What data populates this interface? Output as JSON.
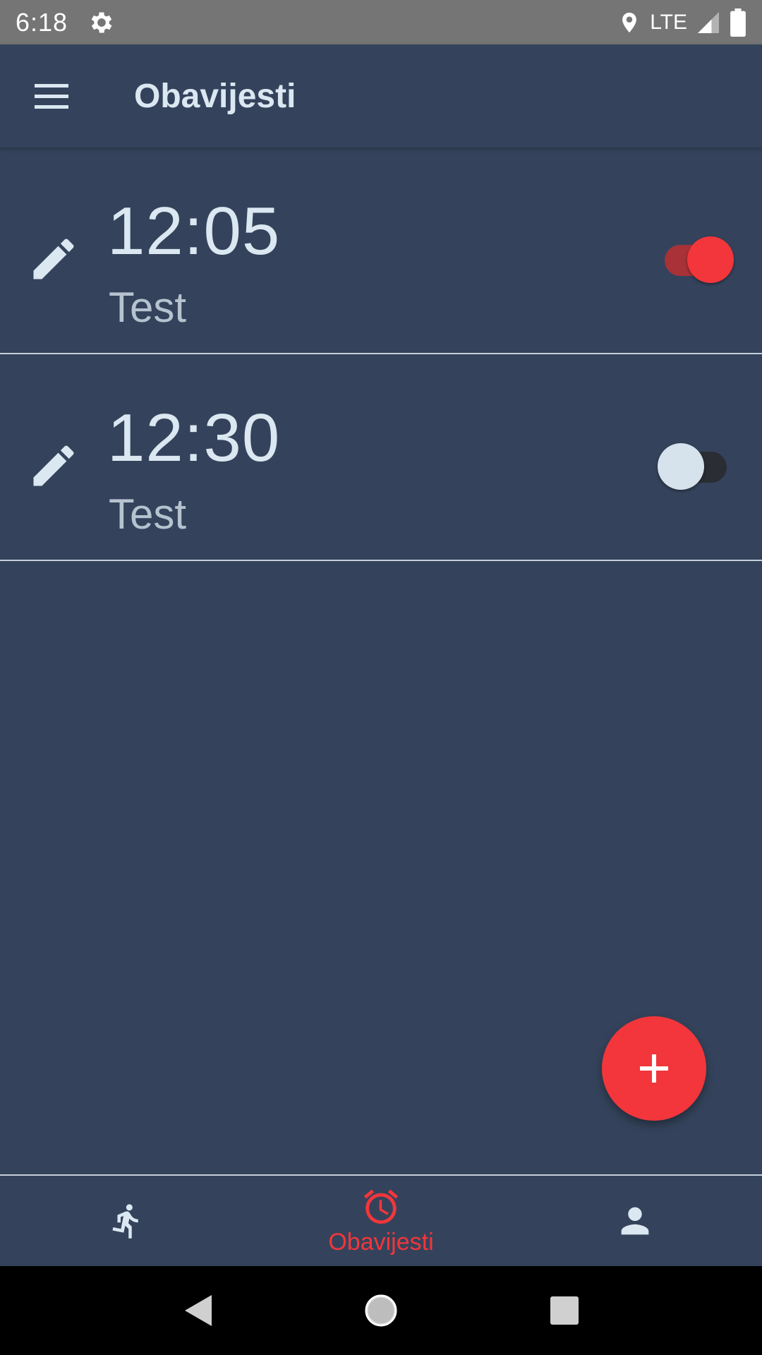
{
  "status_bar": {
    "time": "6:18",
    "network": "LTE",
    "icons": [
      "settings-icon",
      "location-icon",
      "signal-icon",
      "battery-icon"
    ]
  },
  "app_bar": {
    "title": "Obavijesti",
    "menu_icon": "menu-icon"
  },
  "alarms": [
    {
      "time": "12:05",
      "label": "Test",
      "enabled": true
    },
    {
      "time": "12:30",
      "label": "Test",
      "enabled": false
    }
  ],
  "fab": {
    "icon": "plus-icon"
  },
  "bottom_nav": {
    "items": [
      {
        "icon": "running-icon",
        "label": "",
        "active": false
      },
      {
        "icon": "alarm-clock-icon",
        "label": "Obavijesti",
        "active": true
      },
      {
        "icon": "person-icon",
        "label": "",
        "active": false
      }
    ]
  },
  "colors": {
    "background": "#34435b",
    "accent": "#f2363b",
    "text_primary": "#dbe7f1",
    "text_secondary": "#b6c2cf",
    "status_bar": "#757575"
  }
}
